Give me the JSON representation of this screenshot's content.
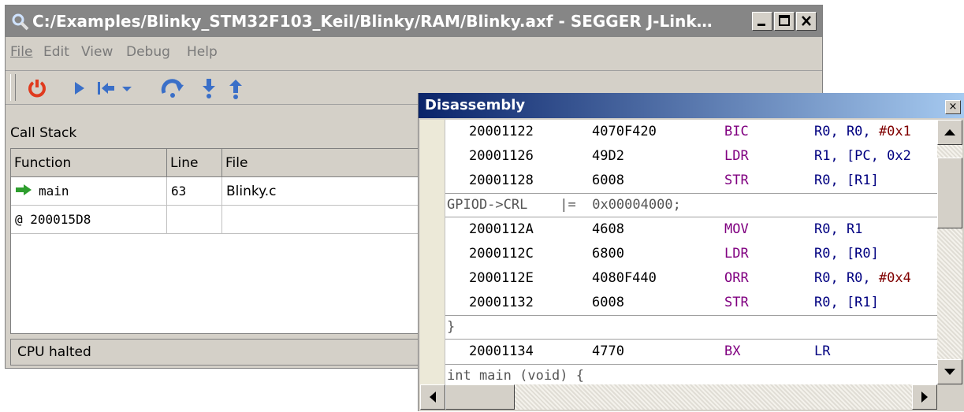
{
  "main_window": {
    "title": "C:/Examples/Blinky_STM32F103_Keil/Blinky/RAM/Blinky.axf - SEGGER J-Link…",
    "menu": [
      "File",
      "Edit",
      "View",
      "Debug",
      "Help"
    ],
    "callstack": {
      "title": "Call Stack",
      "columns": [
        "Function",
        "Line",
        "File"
      ],
      "rows": [
        {
          "function": "main",
          "line": "63",
          "file": "Blinky.c",
          "current": true
        },
        {
          "function": "@ 200015D8",
          "line": "",
          "file": "",
          "current": false
        }
      ]
    },
    "status": "CPU halted"
  },
  "disassembly": {
    "title": "Disassembly",
    "close_glyph": "×",
    "rows": [
      {
        "kind": "asm",
        "addr": "20001122",
        "opcode": "4070F420",
        "mnemonic": "BIC",
        "operands": "R0, R0, ",
        "imm": "#0x1"
      },
      {
        "kind": "asm",
        "addr": "20001126",
        "opcode": "49D2",
        "mnemonic": "LDR",
        "operands": "R1, [PC, 0x2",
        "imm": ""
      },
      {
        "kind": "asm",
        "addr": "20001128",
        "opcode": "6008",
        "mnemonic": "STR",
        "operands": "R0, [R1]",
        "imm": ""
      },
      {
        "kind": "src",
        "text": "GPIOD->CRL    |=  0x00004000;"
      },
      {
        "kind": "asm",
        "addr": "2000112A",
        "opcode": "4608",
        "mnemonic": "MOV",
        "operands": "R0, R1",
        "imm": ""
      },
      {
        "kind": "asm",
        "addr": "2000112C",
        "opcode": "6800",
        "mnemonic": "LDR",
        "operands": "R0, [R0]",
        "imm": ""
      },
      {
        "kind": "asm",
        "addr": "2000112E",
        "opcode": "4080F440",
        "mnemonic": "ORR",
        "operands": "R0, R0, ",
        "imm": "#0x4"
      },
      {
        "kind": "asm",
        "addr": "20001132",
        "opcode": "6008",
        "mnemonic": "STR",
        "operands": "R0, [R1]",
        "imm": ""
      },
      {
        "kind": "src",
        "text": "}"
      },
      {
        "kind": "asm",
        "addr": "20001134",
        "opcode": "4770",
        "mnemonic": "BX",
        "operands": "LR",
        "imm": ""
      },
      {
        "kind": "src",
        "text": "int main (void) {"
      }
    ]
  },
  "icons": {
    "title": "magnifier-icon",
    "toolbar": [
      "power-icon",
      "run-icon",
      "reset-icon",
      "step-over-icon",
      "step-into-icon",
      "step-out-icon"
    ]
  },
  "colors": {
    "title_inactive": "#868686",
    "title_active_start": "#0a246a",
    "mnemonic": "#800080",
    "operand": "#000080",
    "immediate": "#800000",
    "current_arrow": "#2e9e2e",
    "power_icon": "#e03a1e",
    "toolbar_blue": "#3a6fc8"
  }
}
